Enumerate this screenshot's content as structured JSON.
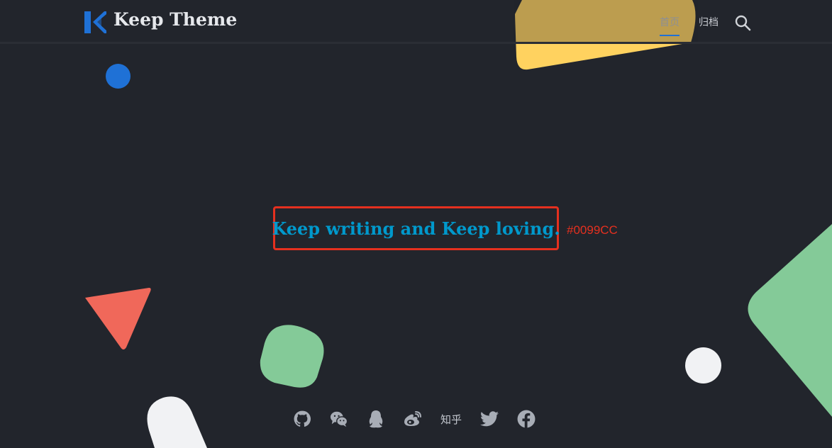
{
  "header": {
    "brand_name": "Keep Theme",
    "logo_icon": "k-logo-icon",
    "nav": [
      {
        "label": "首页",
        "active": true
      },
      {
        "label": "归档",
        "active": false
      }
    ],
    "search_icon": "search-icon"
  },
  "hero": {
    "title": "Keep writing and Keep loving.",
    "title_color": "#0099CC"
  },
  "annotation": {
    "color_label": "#0099CC",
    "box_color": "#E5301F"
  },
  "social": {
    "icons": [
      "github-icon",
      "wechat-icon",
      "qq-icon",
      "weibo-icon",
      "zhihu-text",
      "twitter-icon",
      "facebook-icon"
    ],
    "zhihu_label": "知乎"
  },
  "colors": {
    "background": "#22252C",
    "accent": "#1F71D6",
    "yellow_shape": "#FFD25F",
    "green_shape": "#84CA98",
    "red_shape": "#F0685A",
    "blue_dot": "#1F71D6",
    "white_shape": "#F1F2F4"
  }
}
